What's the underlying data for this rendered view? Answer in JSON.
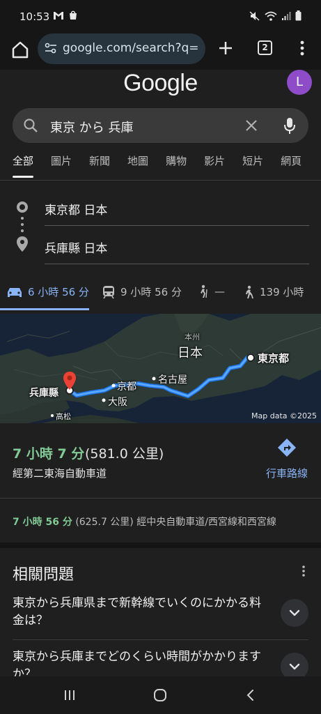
{
  "status_bar": {
    "time": "10:53"
  },
  "browser": {
    "url": "google.com/search?q=",
    "tab_count": "2"
  },
  "google": {
    "logo": "Google",
    "avatar_letter": "L"
  },
  "search": {
    "query": "東京 から 兵庫"
  },
  "tabs": [
    "全部",
    "圖片",
    "新聞",
    "地圖",
    "購物",
    "影片",
    "短片",
    "網頁"
  ],
  "route": {
    "origin": "東京都 日本",
    "destination": "兵庫縣 日本"
  },
  "modes": [
    {
      "icon": "car-icon",
      "label": "6 小時 56 分"
    },
    {
      "icon": "train-icon",
      "label": "9 小時 56 分"
    },
    {
      "icon": "walk-icon",
      "label": "—"
    },
    {
      "icon": "walk-icon",
      "label": "139 小時"
    }
  ],
  "map": {
    "labels": {
      "honshu": "本州",
      "japan": "日本",
      "tokyo": "東京都",
      "nagoya": "名古屋",
      "kyoto": "京都",
      "osaka": "大阪",
      "hyogo": "兵庫縣",
      "takamatsu": "高松"
    },
    "attribution": "Map data ©2025"
  },
  "directions": {
    "time": "7 小時 7 分",
    "distance": "(581.0 公里)",
    "via": "經第二東海自動車道",
    "button_label": "行車路線"
  },
  "alt_route": {
    "time": "7 小時 56 分",
    "detail": "(625.7 公里) 經中央自動車道/西宮線和西宮線"
  },
  "related": {
    "title": "相關問題",
    "questions": [
      "東京から兵庫県まで新幹線でいくのにかかる料金は？",
      "東京から兵庫までどのくらい時間がかかりますか？"
    ]
  },
  "colors": {
    "accent_blue": "#8ab4f8",
    "time_green": "#81c995",
    "background": "#1f1f1f"
  }
}
